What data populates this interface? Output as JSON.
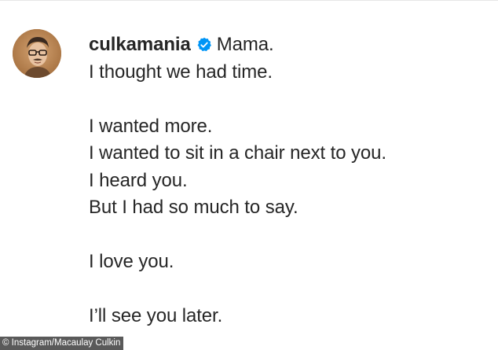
{
  "post": {
    "username": "culkamania",
    "verified_icon": "verified-badge-icon",
    "caption_lines": [
      "Mama.",
      "I thought we had time.",
      "",
      "I wanted more.",
      "I wanted to sit in a chair next to you.",
      "I heard you.",
      "But I had so much to say.",
      "",
      "I love you.",
      "",
      "I’ll see you later."
    ]
  },
  "credit": {
    "text": "© Instagram/Macaulay Culkin"
  },
  "colors": {
    "text": "#262626",
    "verified_blue": "#0095f6",
    "credit_bg": "#5a5a5a"
  }
}
